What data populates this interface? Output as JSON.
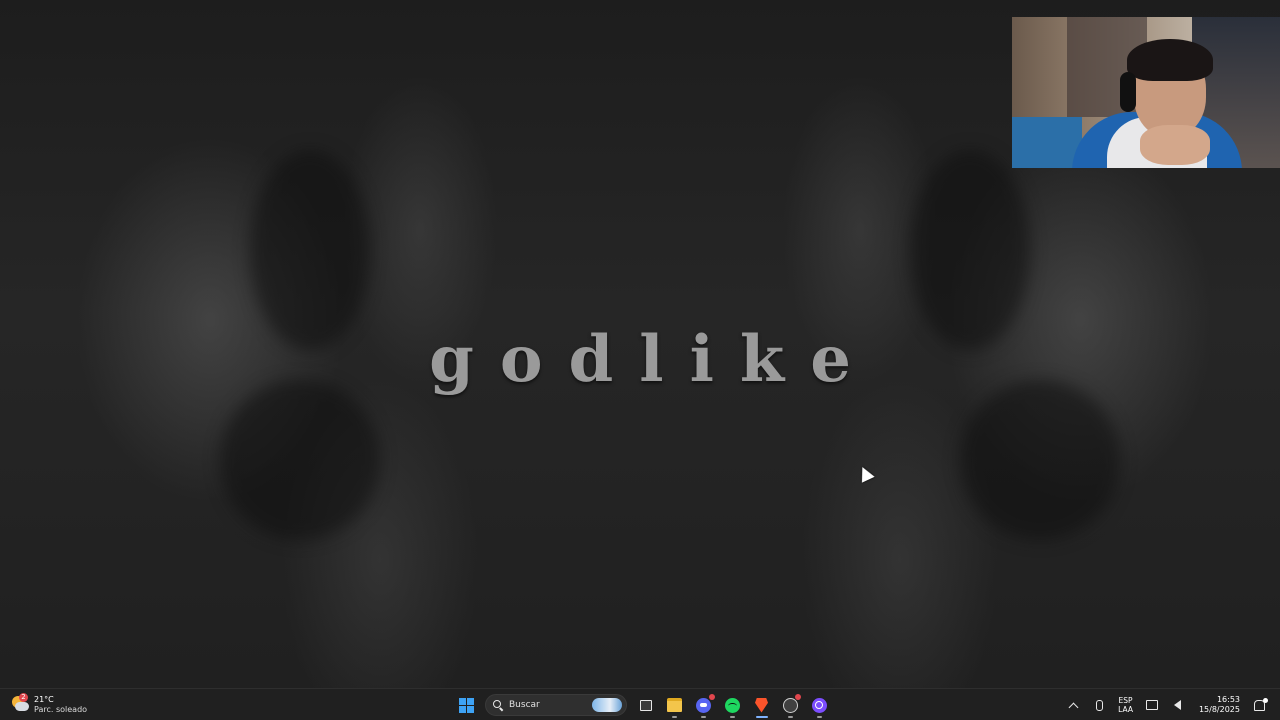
{
  "wallpaper": {
    "title": "godlike"
  },
  "taskbar": {
    "weather": {
      "badge": "2",
      "temperature": "21°C",
      "condition": "Parc. soleado"
    },
    "search": {
      "label": "Buscar"
    },
    "apps": [
      {
        "name": "start",
        "icon": "windows-logo-icon"
      },
      {
        "name": "task-view",
        "icon": "task-view-icon"
      },
      {
        "name": "file-explorer",
        "icon": "folder-icon"
      },
      {
        "name": "discord",
        "icon": "discord-icon"
      },
      {
        "name": "spotify",
        "icon": "spotify-icon"
      },
      {
        "name": "brave",
        "icon": "brave-icon",
        "active": true
      },
      {
        "name": "obs",
        "icon": "obs-icon"
      },
      {
        "name": "app",
        "icon": "ring-icon"
      }
    ],
    "tray": {
      "language_top": "ESP",
      "language_bottom": "LAA",
      "time": "16:53",
      "date": "15/8/2025"
    }
  },
  "colors": {
    "taskbar_bg": "#202020",
    "start_blue": "#3ea3f5",
    "spotify_green": "#1ed760",
    "discord_blurple": "#5865f2",
    "brave_orange": "#fb542b"
  }
}
